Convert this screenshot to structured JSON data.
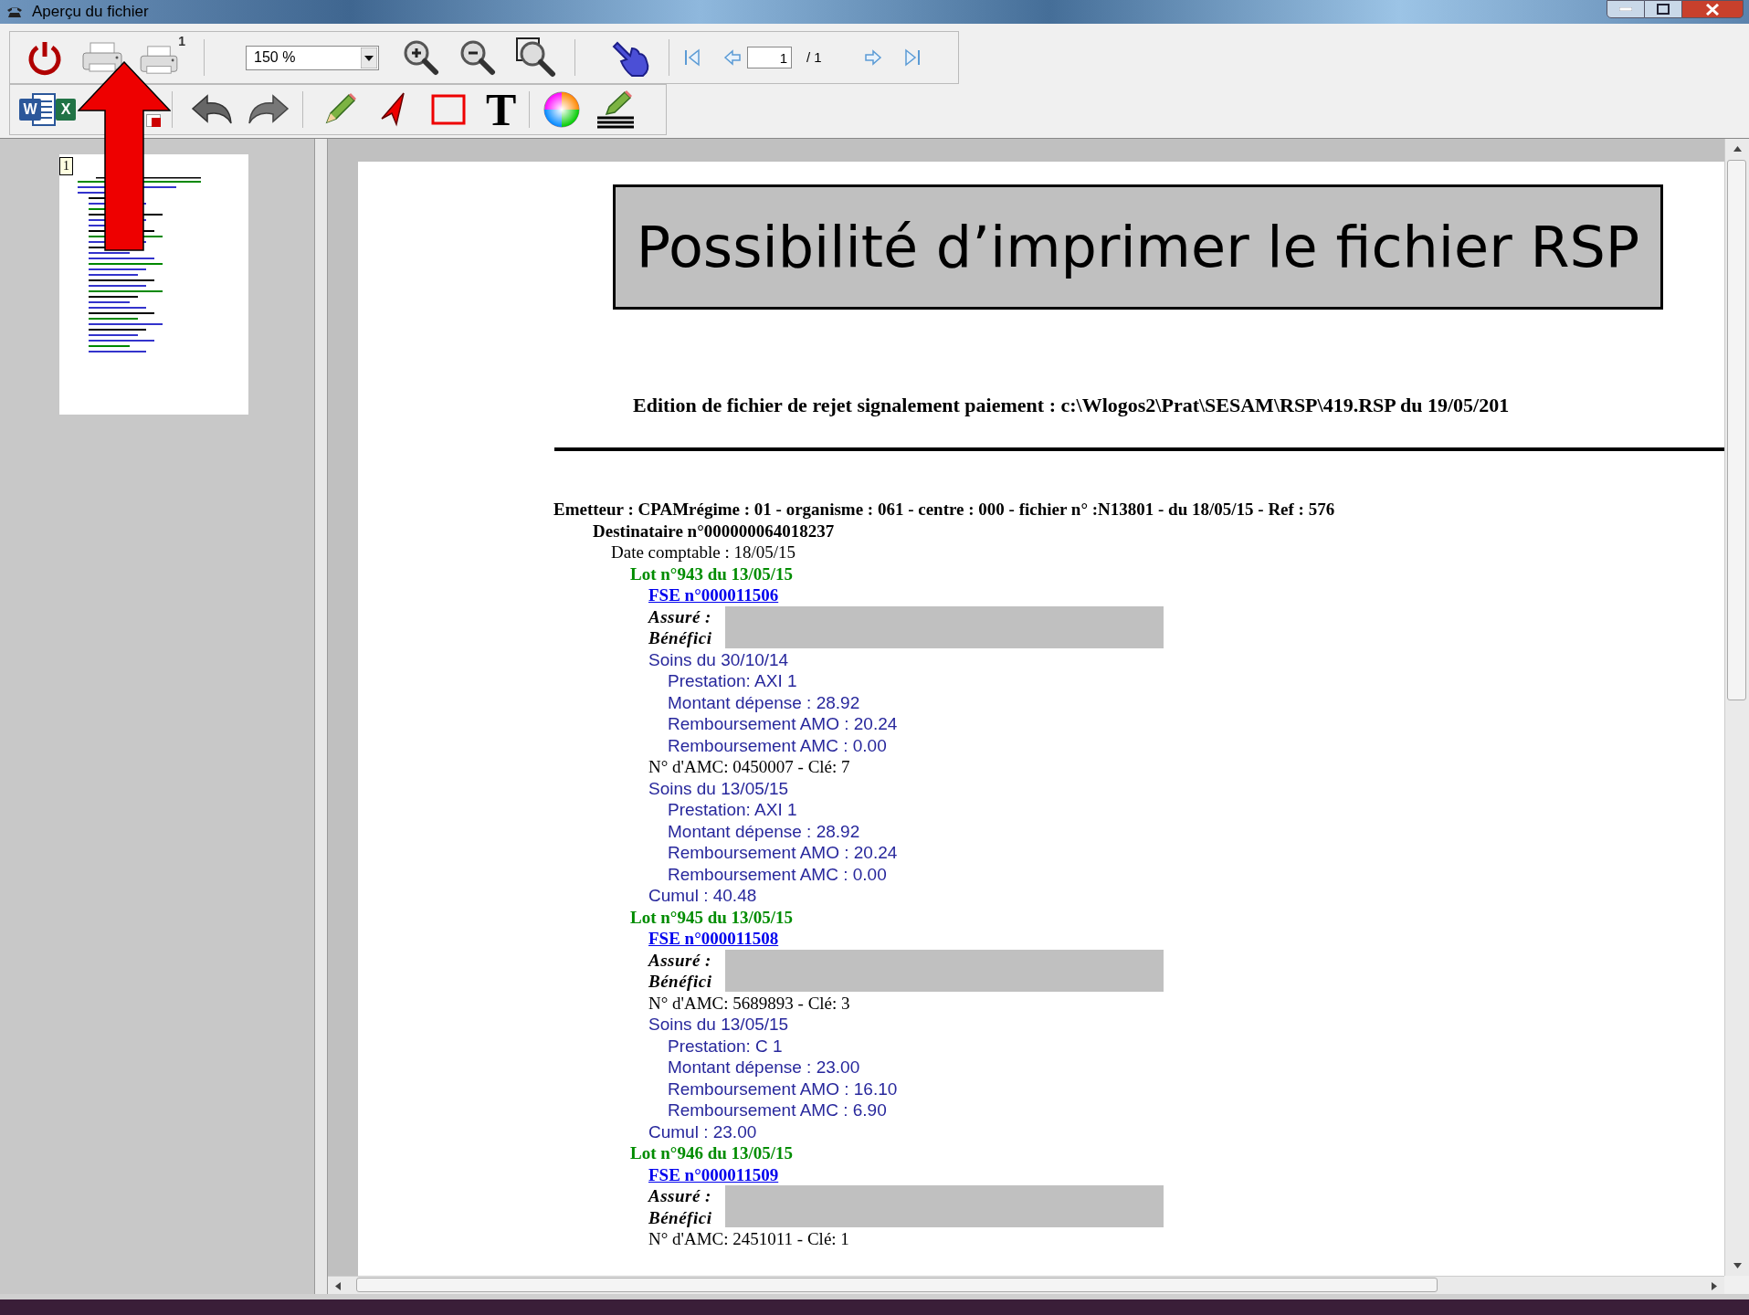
{
  "window": {
    "title": "Aperçu du fichier"
  },
  "toolbar": {
    "print_copies_badge": "1",
    "zoom": "150 %",
    "page": "1",
    "page_total": "/ 1",
    "word_letter": "W",
    "excel_letter": "X",
    "text_tool": "T"
  },
  "thumbnail": {
    "label": "1"
  },
  "document": {
    "banner": "Possibilité d’imprimer le fichier RSP",
    "heading": "Edition de fichier de rejet signalement paiement : c:\\Wlogos2\\Prat\\SESAM\\RSP\\419.RSP du 19/05/201",
    "lines": [
      {
        "kind": "emetteur",
        "text": "Emetteur : CPAMrégime : 01 - organisme : 061 - centre : 000 - fichier n° :N13801 - du 18/05/15 - Ref : 576"
      },
      {
        "kind": "destinataire",
        "text": "Destinataire n°000000064018237"
      },
      {
        "kind": "date",
        "text": "Date comptable : 18/05/15"
      },
      {
        "kind": "lot",
        "text": "Lot n°943 du 13/05/15"
      },
      {
        "kind": "fse",
        "text": "FSE n°000011506"
      },
      {
        "kind": "identity",
        "labels": [
          "Assuré :",
          "Bénéfici"
        ]
      },
      {
        "kind": "soins",
        "text": "Soins du 30/10/14"
      },
      {
        "kind": "detail",
        "text": "Prestation: AXI 1"
      },
      {
        "kind": "detail",
        "text": "Montant dépense : 28.92"
      },
      {
        "kind": "detail",
        "text": "Remboursement AMO : 20.24"
      },
      {
        "kind": "detail",
        "text": "Remboursement AMC : 0.00"
      },
      {
        "kind": "amc",
        "text": "N° d'AMC: 0450007 - Clé: 7"
      },
      {
        "kind": "soins",
        "text": "Soins du 13/05/15"
      },
      {
        "kind": "detail",
        "text": "Prestation: AXI 1"
      },
      {
        "kind": "detail",
        "text": "Montant dépense : 28.92"
      },
      {
        "kind": "detail",
        "text": "Remboursement AMO : 20.24"
      },
      {
        "kind": "detail",
        "text": "Remboursement AMC : 0.00"
      },
      {
        "kind": "soins",
        "text": "Cumul : 40.48"
      },
      {
        "kind": "lot",
        "text": "Lot n°945 du 13/05/15"
      },
      {
        "kind": "fse",
        "text": "FSE n°000011508"
      },
      {
        "kind": "identity",
        "labels": [
          "Assuré :",
          "Bénéfici"
        ]
      },
      {
        "kind": "amc",
        "text": "N° d'AMC: 5689893 - Clé: 3"
      },
      {
        "kind": "soins",
        "text": "Soins du 13/05/15"
      },
      {
        "kind": "detail",
        "text": "Prestation: C 1"
      },
      {
        "kind": "detail",
        "text": "Montant dépense : 23.00"
      },
      {
        "kind": "detail",
        "text": "Remboursement AMO : 16.10"
      },
      {
        "kind": "detail",
        "text": "Remboursement AMC : 6.90"
      },
      {
        "kind": "soins",
        "text": "Cumul : 23.00"
      },
      {
        "kind": "lot",
        "text": "Lot n°946 du 13/05/15"
      },
      {
        "kind": "fse",
        "text": "FSE n°000011509"
      },
      {
        "kind": "identity",
        "labels": [
          "Assuré :",
          "Bénéfici"
        ]
      },
      {
        "kind": "amc",
        "text": "N° d'AMC: 2451011 - Clé: 1"
      }
    ]
  }
}
